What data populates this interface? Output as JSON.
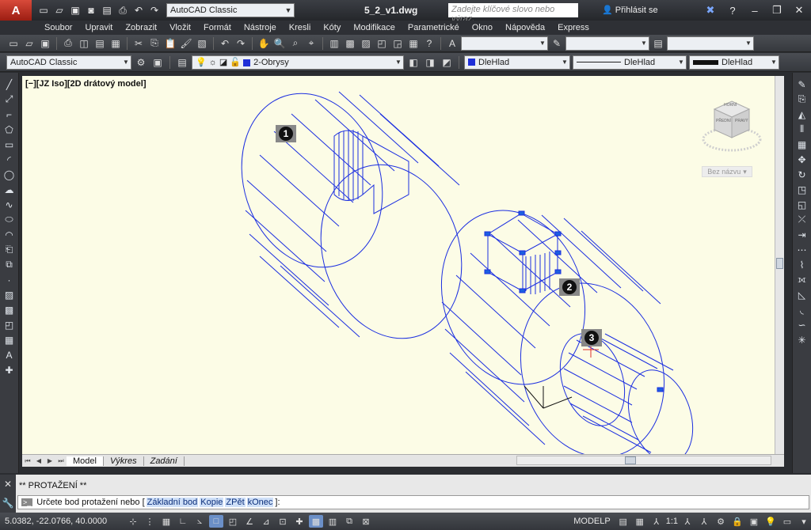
{
  "titlebar": {
    "app_logo": "A",
    "workspace": "AutoCAD Classic",
    "document_title": "5_2_v1.dwg",
    "search_placeholder": "Zadejte klíčové slovo nebo výraz.",
    "login_label": "Přihlásit se"
  },
  "menu": {
    "items": [
      "Soubor",
      "Upravit",
      "Zobrazit",
      "Vložit",
      "Formát",
      "Nástroje",
      "Kresli",
      "Kóty",
      "Modifikace",
      "Parametrické",
      "Okno",
      "Nápověda",
      "Express"
    ]
  },
  "toolbar2": {
    "workspace": "AutoCAD Classic",
    "layer": "2-Obrysy",
    "color": "DleHlad",
    "linetype": "DleHlad",
    "lineweight": "DleHlad",
    "layer_swatch_color": "#1f2fd8",
    "color_swatch_color": "#1f2fd8"
  },
  "viewport": {
    "label": "[−][JZ Iso][2D drátový model]",
    "viewcube_top": "HORNÍ",
    "viewcube_front": "PŘEDNÍ",
    "viewcube_right": "PRAVÝ",
    "ucs_name": "Bez názvu",
    "markers": [
      "1",
      "2",
      "3"
    ],
    "background": "#fcfce6",
    "line_color": "#1c2fe0"
  },
  "layout_tabs": {
    "tabs": [
      "Model",
      "Výkres",
      "Zadání"
    ],
    "active": "Model"
  },
  "command": {
    "history": "** PROTAŽENÍ **",
    "prompt": "Určete bod protažení nebo [",
    "options": [
      "Základní bod",
      "Kopie",
      "ZPět",
      "kOnec"
    ],
    "prompt_end": "]:"
  },
  "statusbar": {
    "coordinates": "5.0382, -22.0766, 40.0000",
    "space": "MODELP",
    "scale": "1:1"
  }
}
